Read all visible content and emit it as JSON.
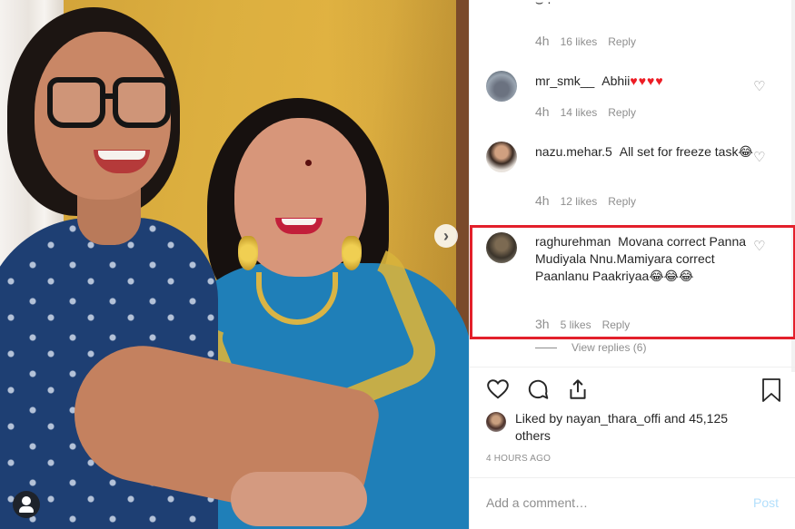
{
  "photo": {
    "icons": {
      "next": "chevron-right-icon",
      "profile": "person-icon"
    }
  },
  "comments": {
    "top": {
      "time": "4h",
      "likes": "16 likes",
      "reply": "Reply"
    },
    "items": [
      {
        "user": "mr_smk__",
        "text": "Abhii",
        "emoji": "♥♥♥♥",
        "time": "4h",
        "likes": "14 likes",
        "reply": "Reply"
      },
      {
        "user": "nazu.mehar.5",
        "text": "All set for freeze task",
        "emoji": "😂",
        "time": "4h",
        "likes": "12 likes",
        "reply": "Reply"
      },
      {
        "user": "raghurehman",
        "text": "Movana correct Panna Mudiyala Nnu.Mamiyara correct Paanlanu Paakriyaa",
        "emoji": "😂😂😂",
        "time": "3h",
        "likes": "5 likes",
        "reply": "Reply"
      }
    ],
    "view_replies": "View replies (6)"
  },
  "footer": {
    "liked_by": "Liked by nayan_thara_offi and 45,125 others",
    "timestamp": "4 HOURS AGO",
    "add_comment_placeholder": "Add a comment…",
    "post_label": "Post"
  },
  "colors": {
    "highlight": "#e3202b",
    "heart": "#ed1c24",
    "post": "#b2dffc",
    "muted": "#8e8e8e"
  }
}
